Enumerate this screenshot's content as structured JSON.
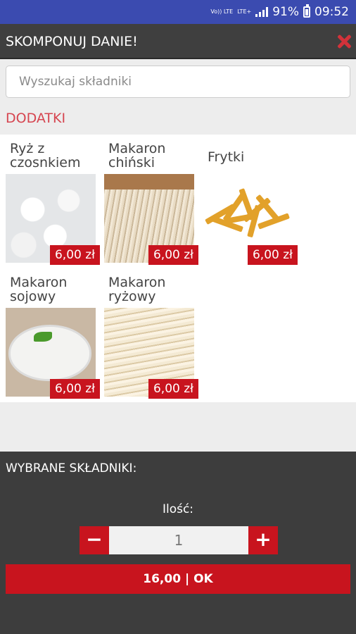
{
  "status": {
    "volte": "Vo)) LTE",
    "lte": "LTE+",
    "battery": "91%",
    "time": "09:52"
  },
  "header": {
    "title": "SKOMPONUJ DANIE!",
    "close_icon": "close-icon"
  },
  "search": {
    "placeholder": "Wyszukaj składniki",
    "value": ""
  },
  "section": {
    "label": "DODATKI"
  },
  "items": [
    {
      "name": "Ryż z czosnkiem",
      "price": "6,00 zł"
    },
    {
      "name": "Makaron chiński",
      "price": "6,00 zł"
    },
    {
      "name": "Frytki",
      "price": "6,00 zł"
    },
    {
      "name": "Makaron sojowy",
      "price": "6,00 zł"
    },
    {
      "name": "Makaron ryżowy",
      "price": "6,00 zł"
    }
  ],
  "selected": {
    "title": "WYBRANE SKŁADNIKI:",
    "qty_label": "Ilość:",
    "qty_value": "1",
    "minus": "−",
    "plus": "+",
    "ok_label": "16,00 | OK"
  },
  "colors": {
    "accent": "#c8141e",
    "section": "#d64550",
    "statusbar": "#3b4bb0",
    "toolbar": "#3f3f3f"
  }
}
